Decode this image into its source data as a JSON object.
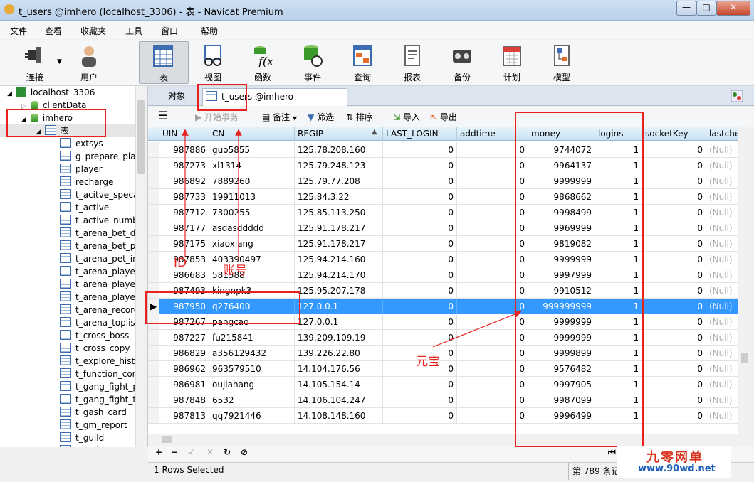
{
  "window": {
    "title": "t_users @imhero (localhost_3306) - 表 - Navicat Premium",
    "minimize": "—",
    "maximize": "□",
    "close": "✕"
  },
  "menu": [
    "文件",
    "查看",
    "收藏夹",
    "工具",
    "窗口",
    "帮助"
  ],
  "toolbar": [
    {
      "label": "连接",
      "icon": "plug-icon"
    },
    {
      "label": "用户",
      "icon": "user-icon"
    },
    {
      "label": "表",
      "icon": "table-icon",
      "active": true
    },
    {
      "label": "视图",
      "icon": "view-glasses-icon"
    },
    {
      "label": "函数",
      "icon": "function-icon"
    },
    {
      "label": "事件",
      "icon": "event-clock-icon"
    },
    {
      "label": "查询",
      "icon": "query-icon"
    },
    {
      "label": "报表",
      "icon": "report-icon"
    },
    {
      "label": "备份",
      "icon": "backup-tape-icon"
    },
    {
      "label": "计划",
      "icon": "calendar-icon"
    },
    {
      "label": "模型",
      "icon": "model-icon"
    }
  ],
  "tree": {
    "server": "localhost_3306",
    "db1": "clientData",
    "db2": "imhero",
    "folder": "表",
    "tables": [
      "extsys",
      "g_prepare_play",
      "player",
      "recharge",
      "t_acitve_specai",
      "t_active",
      "t_active_numbe",
      "t_arena_bet_de",
      "t_arena_bet_pla",
      "t_arena_pet_inf",
      "t_arena_player",
      "t_arena_player_",
      "t_arena_player_",
      "t_arena_record",
      "t_arena_toplist",
      "t_cross_boss",
      "t_cross_copy_c",
      "t_explore_histo",
      "t_function_cont",
      "t_gang_fight_pl",
      "t_gang_fight_te",
      "t_gash_card",
      "t_gm_report",
      "t_guild",
      "t_guild_mem"
    ]
  },
  "tabs": {
    "objects": "对象",
    "current": "t_users @imhero (localhost_..."
  },
  "gridtools": {
    "begin_tx": "开始事务",
    "memo": "备注",
    "filter": "筛选",
    "sort": "排序",
    "import": "导入",
    "export": "导出"
  },
  "columns": [
    "UIN",
    "CN",
    "REGIP",
    "LAST_LOGIN",
    "addtime",
    "money",
    "logins",
    "socketKey",
    "lastche"
  ],
  "rows": [
    [
      "987886",
      "guo5855",
      "125.78.208.160",
      "0",
      "0",
      "9744072",
      "1",
      "0",
      "(Null)"
    ],
    [
      "987273",
      "xl1314",
      "125.79.248.123",
      "0",
      "0",
      "9964137",
      "1",
      "0",
      "(Null)"
    ],
    [
      "986892",
      "7889260",
      "125.79.77.208",
      "0",
      "0",
      "9999999",
      "1",
      "0",
      "(Null)"
    ],
    [
      "987733",
      "19911013",
      "125.84.3.22",
      "0",
      "0",
      "9868662",
      "1",
      "0",
      "(Null)"
    ],
    [
      "987712",
      "7300255",
      "125.85.113.250",
      "0",
      "0",
      "9998499",
      "1",
      "0",
      "(Null)"
    ],
    [
      "987177",
      "asdasddddd",
      "125.91.178.217",
      "0",
      "0",
      "9969999",
      "1",
      "0",
      "(Null)"
    ],
    [
      "987175",
      "xiaoxiang",
      "125.91.178.217",
      "0",
      "0",
      "9819082",
      "1",
      "0",
      "(Null)"
    ],
    [
      "987853",
      "403390497",
      "125.94.214.160",
      "0",
      "0",
      "9999999",
      "1",
      "0",
      "(Null)"
    ],
    [
      "986683",
      "581588",
      "125.94.214.170",
      "0",
      "0",
      "9997999",
      "1",
      "0",
      "(Null)"
    ],
    [
      "987493",
      "kingnpk3",
      "125.95.207.178",
      "0",
      "0",
      "9910512",
      "1",
      "0",
      "(Null)"
    ],
    [
      "987950",
      "q276400",
      "127.0.0.1",
      "0",
      "0",
      "999999999",
      "1",
      "0",
      "(Null)"
    ],
    [
      "987267",
      "pangcao",
      "127.0.0.1",
      "0",
      "0",
      "9999999",
      "1",
      "0",
      "(Null)"
    ],
    [
      "987227",
      "fu215841",
      "139.209.109.19",
      "0",
      "0",
      "9999999",
      "1",
      "0",
      "(Null)"
    ],
    [
      "986829",
      "a356129432",
      "139.226.22.80",
      "0",
      "0",
      "9999899",
      "1",
      "0",
      "(Null)"
    ],
    [
      "986962",
      "963579510",
      "14.104.176.56",
      "0",
      "0",
      "9576482",
      "1",
      "0",
      "(Null)"
    ],
    [
      "986981",
      "oujiahang",
      "14.105.154.14",
      "0",
      "0",
      "9997905",
      "1",
      "0",
      "(Null)"
    ],
    [
      "987848",
      "6532",
      "14.106.104.247",
      "0",
      "0",
      "9987099",
      "1",
      "0",
      "(Null)"
    ],
    [
      "987813",
      "qq7921446",
      "14.108.148.160",
      "0",
      "0",
      "9996499",
      "1",
      "0",
      "(Null)"
    ]
  ],
  "selected_row": 10,
  "navbar": [
    "+",
    "−",
    "✓",
    "✕",
    "↻",
    "⊘"
  ],
  "status": {
    "left": "1 Rows Selected",
    "right": "第 789 条记"
  },
  "annotations": {
    "id": "ID",
    "account": "账号",
    "yuanbao": "元宝"
  },
  "watermark": {
    "name": "九零网单",
    "url": "www.90wd.net"
  }
}
